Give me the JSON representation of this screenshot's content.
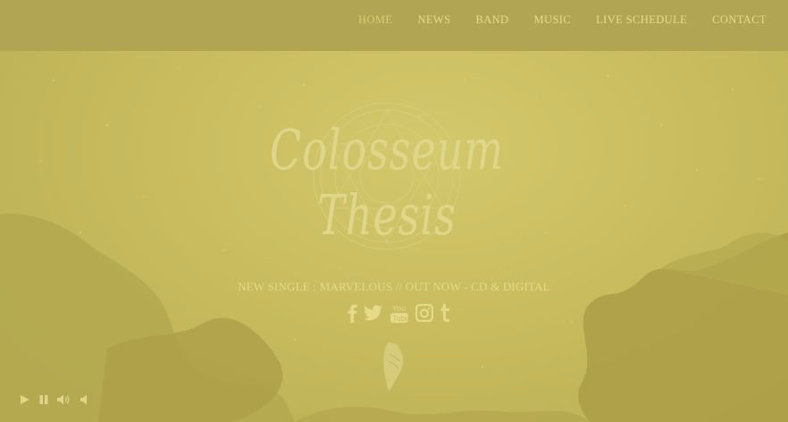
{
  "nav": {
    "items": [
      {
        "label": "HOME",
        "active": true
      },
      {
        "label": "NEWS"
      },
      {
        "label": "BAND"
      },
      {
        "label": "MUSIC"
      },
      {
        "label": "LIVE SCHEDULE"
      },
      {
        "label": "CONTACT"
      }
    ]
  },
  "logo": {
    "text": "Colosseum Thesis"
  },
  "announcement": "NEW SINGLE : MARVELOUS // OUT NOW - CD & DIGITAL",
  "social": {
    "icons": [
      "facebook-icon",
      "twitter-icon",
      "youtube-icon",
      "instagram-icon",
      "tumblr-icon"
    ]
  },
  "player": {
    "icons": [
      "play-icon",
      "pause-icon",
      "volume-icon",
      "mute-icon"
    ]
  },
  "colors": {
    "topbar": "#b1a452",
    "background": "#c9bd60",
    "text": "#e4da8a"
  }
}
